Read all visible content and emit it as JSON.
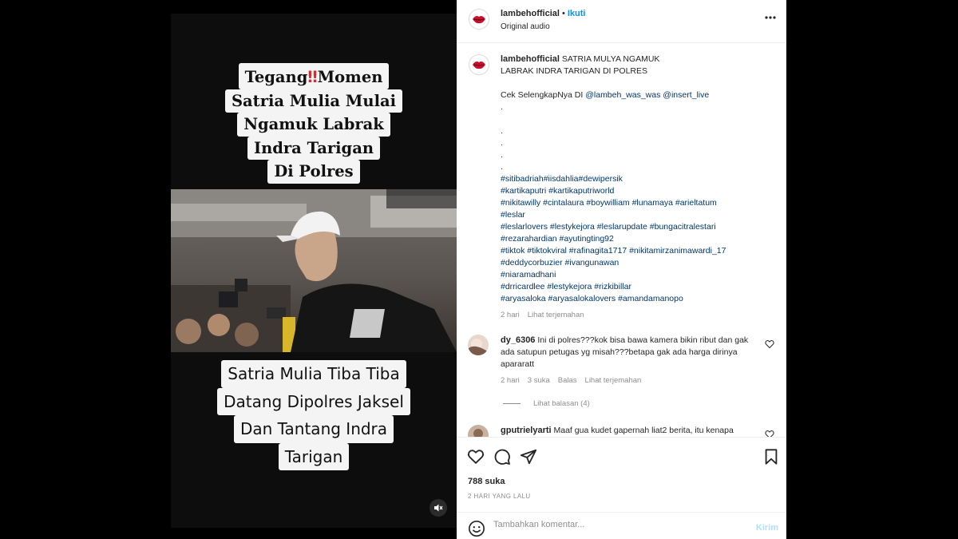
{
  "post": {
    "username": "lambehofficial",
    "dot": "•",
    "follow_label": "Ikuti",
    "audio": "Original audio",
    "caption_title": "SATRIA MULYA NGAMUK LABRAK INDRA TARIGAN DI POLRES",
    "caption_link_prefix": "Cek SelengkapNya DI",
    "mention1": "@lambeh_was_was",
    "mention2": "@insert_live",
    "dot_line": ".",
    "hashtag_lines": [
      "#sitibadriah#iisdahlia#dewipersik",
      "#kartikaputri #kartikaputriworld",
      "#nikitawilly #cintalaura #boywilliam #lunamaya #arieltatum",
      "#leslar",
      "#leslarlovers #lestykejora #leslarupdate #bungacitralestari",
      "#rezarahardian #ayutingting92",
      "#tiktok #tiktokviral #rafinagita1717 #nikitamirzanimawardi_17",
      "#deddycorbuzier #ivangunawan",
      "#niaramadhani",
      "#drricardlee #lestykejora #rizkibillar",
      "#aryasaloka #aryasalokalovers #amandamanopo"
    ],
    "caption_time": "2 hari",
    "see_translation": "Lihat terjemahan"
  },
  "video": {
    "caption_top": [
      {
        "before": "Tegang",
        "emoji": "‼",
        "after": "Momen"
      },
      {
        "text": "Satria Mulia Mulai"
      },
      {
        "text": "Ngamuk Labrak"
      },
      {
        "text": "Indra Tarigan"
      },
      {
        "text": "Di Polres"
      }
    ],
    "caption_bottom": [
      "Satria Mulia Tiba Tiba",
      "Datang Dipolres Jaksel",
      "Dan Tantang Indra",
      "Tarigan"
    ]
  },
  "comments": [
    {
      "username": "dy_6306",
      "text": "Ini di polres???kok bisa bawa kamera bikin ribut dan gak ada satupun petugas yg misah???betapa gak ada harga dirinya apararatt",
      "time": "2 hari",
      "likes": "3 suka",
      "reply": "Balas",
      "translate": "Lihat terjemahan",
      "view_replies": "Lihat balasan (4)"
    },
    {
      "username": "gputrielyarti",
      "text": "Maaf gua kudet gapernah liat2 berita, itu kenapa"
    }
  ],
  "actions": {
    "likes": "788 suka",
    "date": "2 HARI YANG LALU"
  },
  "composer": {
    "placeholder": "Tambahkan komentar...",
    "post_label": "Kirim"
  },
  "colors": {
    "link_blue": "#0095f6",
    "hashtag": "#00376b",
    "muted": "#8e8e8e",
    "post_disabled": "#b2dffc"
  }
}
